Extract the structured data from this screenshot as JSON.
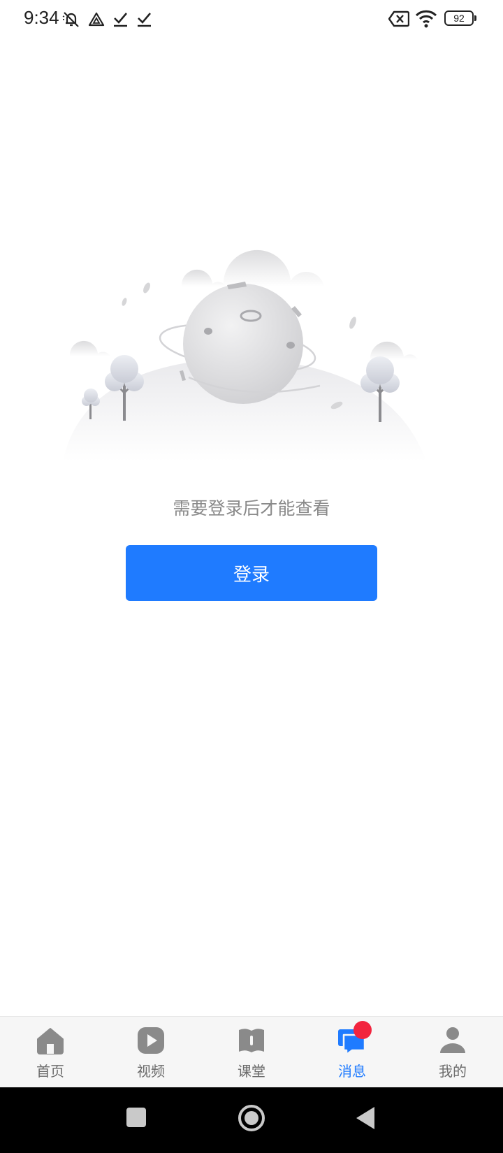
{
  "status_bar": {
    "time": "9:34",
    "battery": "92",
    "icons": [
      "bell-off-icon",
      "drive-icon",
      "check-icon",
      "check-icon",
      "sim-x-icon",
      "wifi-icon",
      "battery-icon"
    ]
  },
  "main": {
    "message": "需要登录后才能查看",
    "login_button": "登录"
  },
  "tabs": [
    {
      "label": "首页",
      "icon": "home-icon",
      "active": false
    },
    {
      "label": "视频",
      "icon": "play-icon",
      "active": false
    },
    {
      "label": "课堂",
      "icon": "book-icon",
      "active": false
    },
    {
      "label": "消息",
      "icon": "message-icon",
      "active": true,
      "badge": true
    },
    {
      "label": "我的",
      "icon": "person-icon",
      "active": false
    }
  ],
  "nav_bar": {
    "buttons": [
      "recents-button",
      "home-button",
      "back-button"
    ]
  },
  "colors": {
    "accent": "#1f7bff",
    "badge": "#f2243e",
    "tab_inactive": "#6b6b6b",
    "message_text": "#8a8a8a"
  }
}
